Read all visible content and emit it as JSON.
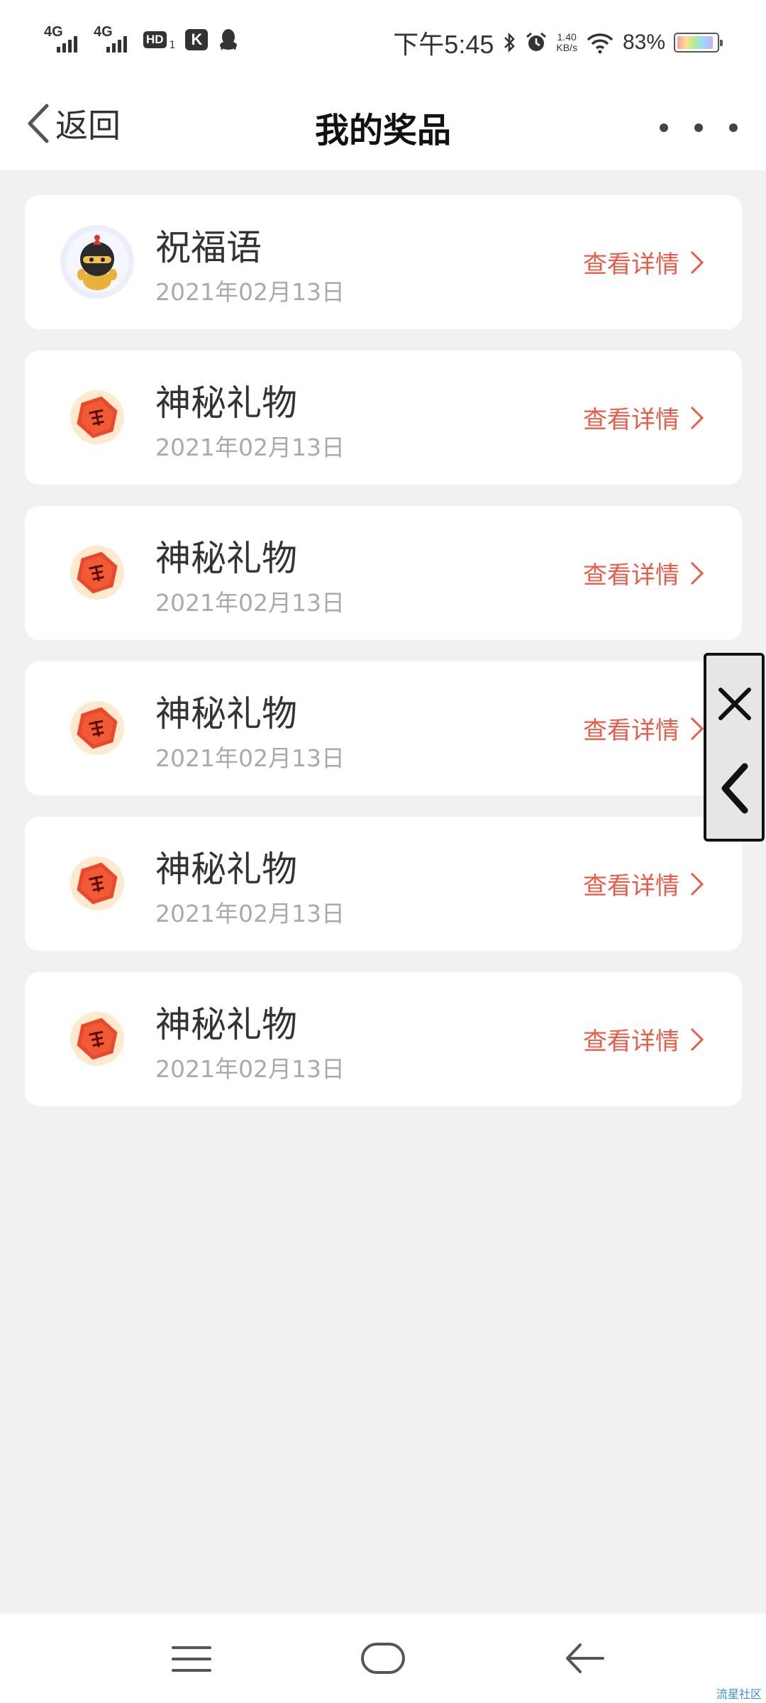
{
  "status_bar": {
    "signal_1": "4G",
    "signal_2": "4G",
    "hd": "HD",
    "hd_sub": "1",
    "k": "K",
    "time": "下午5:45",
    "speed_value": "1.40",
    "speed_unit": "KB/s",
    "battery": "83%",
    "battery_level": 0.83
  },
  "header": {
    "back_label": "返回",
    "title": "我的奖品"
  },
  "prizes": [
    {
      "name": "祝福语",
      "date": "2021年02月13日",
      "detail": "查看详情",
      "icon": "mascot-icon"
    },
    {
      "name": "神秘礼物",
      "date": "2021年02月13日",
      "detail": "查看详情",
      "icon": "fu-hexagon-icon"
    },
    {
      "name": "神秘礼物",
      "date": "2021年02月13日",
      "detail": "查看详情",
      "icon": "fu-hexagon-icon"
    },
    {
      "name": "神秘礼物",
      "date": "2021年02月13日",
      "detail": "查看详情",
      "icon": "fu-hexagon-icon"
    },
    {
      "name": "神秘礼物",
      "date": "2021年02月13日",
      "detail": "查看详情",
      "icon": "fu-hexagon-icon"
    },
    {
      "name": "神秘礼物",
      "date": "2021年02月13日",
      "detail": "查看详情",
      "icon": "fu-hexagon-icon"
    }
  ],
  "watermark": "流星社区",
  "colors": {
    "accent": "#e85d4a",
    "background": "#f1f1f1",
    "card": "#ffffff"
  }
}
